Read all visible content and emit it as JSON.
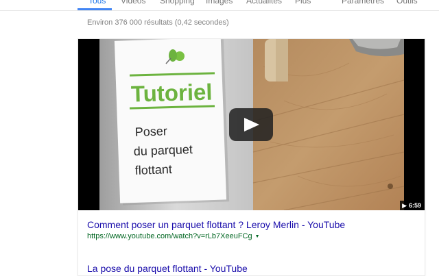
{
  "nav": {
    "tabs": [
      "Tous",
      "Vidéos",
      "Shopping",
      "Images",
      "Actualités",
      "Plus",
      "Paramètres",
      "Outils"
    ],
    "active_tab": "Tous"
  },
  "results": {
    "stats": "Environ 376 000 résultats (0,42 secondes)",
    "video": {
      "thumbnail_text": {
        "heading": "Tutoriel",
        "line1": "Poser",
        "line2": "du parquet",
        "line3": "flottant"
      },
      "duration": "6:59",
      "title": "Comment poser un parquet flottant ? Leroy Merlin - YouTube",
      "url": "https://www.youtube.com/watch?v=rLb7XeeuFCg"
    },
    "second_title": "La pose du parquet flottant - YouTube"
  },
  "colors": {
    "accent": "#4285f4",
    "link": "#1a0dab",
    "url": "#006621",
    "tutoriel_green": "#6cb33f"
  },
  "icons": [
    "play-icon",
    "pushpin-icon",
    "dropdown-caret-icon"
  ]
}
